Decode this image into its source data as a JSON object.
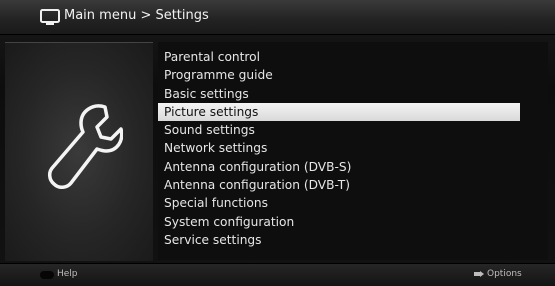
{
  "header": {
    "title": "Main menu > Settings",
    "icon": "tv-icon"
  },
  "panel": {
    "icon": "wrench-icon"
  },
  "menu": {
    "items": [
      {
        "label": "Parental control",
        "selected": false
      },
      {
        "label": "Programme guide",
        "selected": false
      },
      {
        "label": "Basic settings",
        "selected": false
      },
      {
        "label": "Picture settings",
        "selected": true
      },
      {
        "label": "Sound settings",
        "selected": false
      },
      {
        "label": "Network settings",
        "selected": false
      },
      {
        "label": "Antenna configuration (DVB-S)",
        "selected": false
      },
      {
        "label": "Antenna configuration (DVB-T)",
        "selected": false
      },
      {
        "label": "Special functions",
        "selected": false
      },
      {
        "label": "System configuration",
        "selected": false
      },
      {
        "label": "Service settings",
        "selected": false
      }
    ]
  },
  "footer": {
    "help_label": "Help",
    "options_label": "Options"
  },
  "colors": {
    "selection": "#e8e8e8",
    "background": "#101010"
  }
}
